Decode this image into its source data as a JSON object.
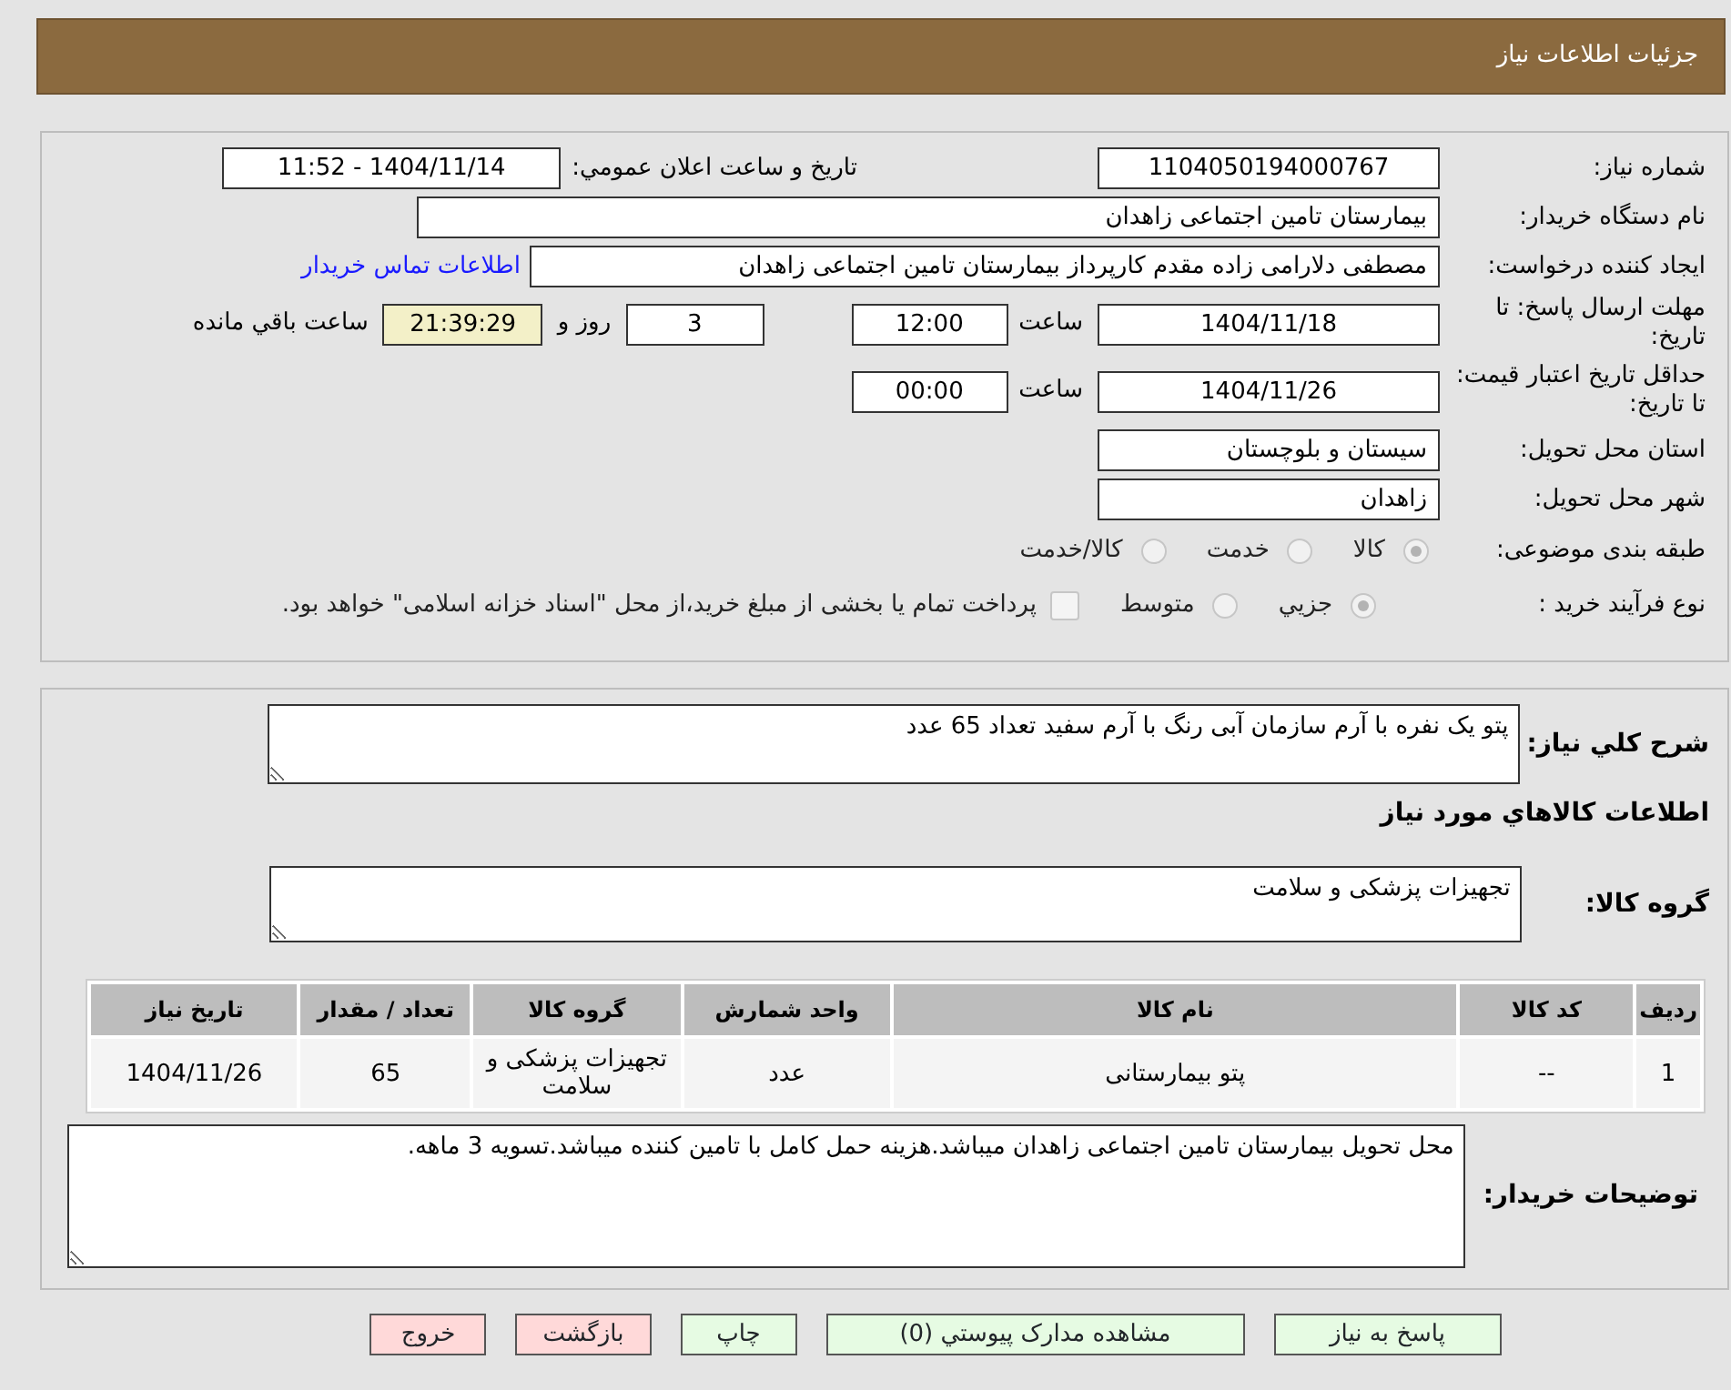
{
  "header": {
    "title": "جزئیات اطلاعات نیاز"
  },
  "need_number": {
    "label": "شماره نیاز:",
    "value": "1104050194000767"
  },
  "announce": {
    "label": "تاریخ و ساعت اعلان عمومي:",
    "value": "1404/11/14 - 11:52"
  },
  "buyer_org": {
    "label": "نام دستگاه خریدار:",
    "value": "بیمارستان تامین اجتماعی زاهدان"
  },
  "requester": {
    "label": "ایجاد کننده درخواست:",
    "value": "مصطفی دلارامی زاده مقدم کارپرداز بیمارستان تامین اجتماعی زاهدان",
    "link": "اطلاعات تماس خریدار"
  },
  "response_deadline": {
    "label": "مهلت ارسال پاسخ: تا تاریخ:",
    "date": "1404/11/18",
    "time_label": "ساعت",
    "time": "12:00",
    "days": "3",
    "days_label": "روز و",
    "remaining": "21:39:29",
    "remaining_label": "ساعت باقي مانده"
  },
  "validity": {
    "label": "حداقل تاریخ اعتبار قیمت: تا تاریخ:",
    "date": "1404/11/26",
    "time_label": "ساعت",
    "time": "00:00"
  },
  "province": {
    "label": "استان محل تحویل:",
    "value": "سیستان و بلوچستان"
  },
  "city": {
    "label": "شهر محل تحویل:",
    "value": "زاهدان"
  },
  "category": {
    "label": "طبقه بندی موضوعی:",
    "options": [
      {
        "label": "کالا",
        "selected": true
      },
      {
        "label": "خدمت",
        "selected": false
      },
      {
        "label": "کالا/خدمت",
        "selected": false
      }
    ]
  },
  "process": {
    "label": "نوع فرآیند خرید :",
    "options": [
      {
        "label": "جزيي",
        "selected": true
      },
      {
        "label": "متوسط",
        "selected": false
      }
    ],
    "payment": {
      "label": "پرداخت تمام یا بخشی از مبلغ خرید،از محل \"اسناد خزانه اسلامی\" خواهد بود.",
      "checked": false
    }
  },
  "description": {
    "label": "شرح کلي نياز:",
    "value": "پتو یک نفره با آرم سازمان آبی رنگ با آرم سفید تعداد 65 عدد"
  },
  "goods_heading": "اطلاعات کالاهاي مورد نياز",
  "goods_group": {
    "label": "گروه کالا:",
    "value": "تجهیزات پزشکی و سلامت"
  },
  "table": {
    "columns": [
      "ردیف",
      "کد کالا",
      "نام کالا",
      "واحد شمارش",
      "گروه کالا",
      "تعداد / مقدار",
      "تاریخ نیاز"
    ],
    "rows": [
      [
        "1",
        "--",
        "پتو بیمارستانی",
        "عدد",
        "تجهیزات پزشکی و سلامت",
        "65",
        "1404/11/26"
      ]
    ]
  },
  "buyer_notes": {
    "label": "توضیحات خریدار:",
    "value": "محل تحویل بیمارستان تامین اجتماعی زاهدان میباشد.هزینه حمل کامل با تامین کننده میباشد.تسویه 3 ماهه."
  },
  "buttons": [
    {
      "label": "پاسخ به نیاز",
      "kind": "green"
    },
    {
      "label": "مشاهده مدارک پیوستي (0)",
      "kind": "green"
    },
    {
      "label": "چاپ",
      "kind": "green"
    },
    {
      "label": "بازگشت",
      "kind": "red"
    },
    {
      "label": "خروج",
      "kind": "red"
    }
  ]
}
